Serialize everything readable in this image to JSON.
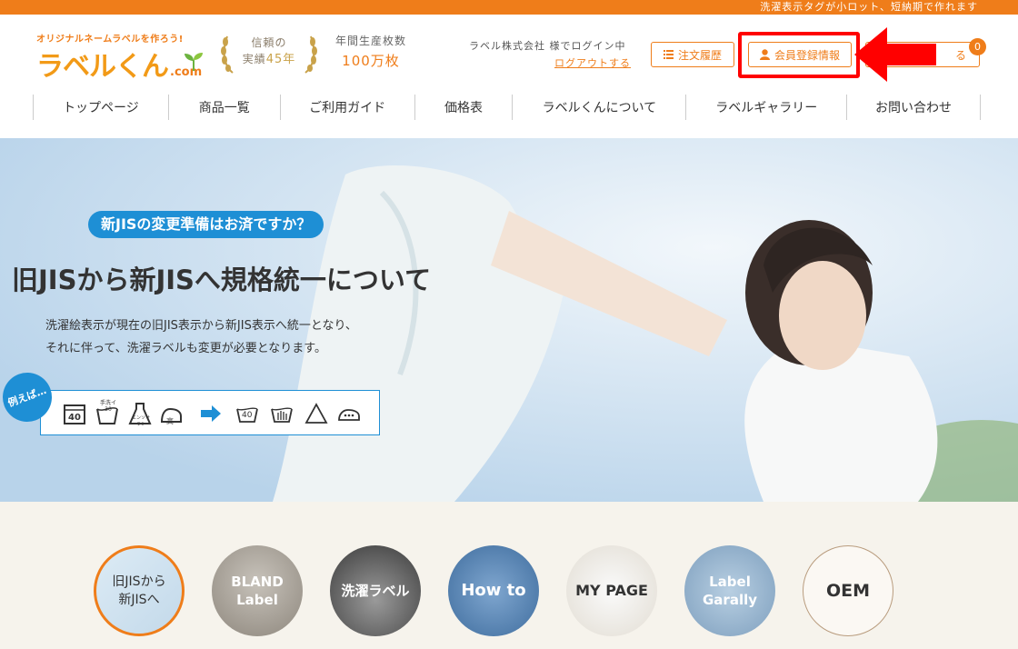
{
  "topbar": {
    "notice": "洗濯表示タグが小ロット、短納期で作れます"
  },
  "logo": {
    "tagline": "オリジナルネームラベルを作ろう!",
    "name": "ラベルくん",
    "domain": ".com"
  },
  "award": {
    "line1": "信頼の",
    "line2_prefix": "実績",
    "years": "45年"
  },
  "production": {
    "label": "年間生産枚数",
    "value": "100万枚"
  },
  "account": {
    "login_status": "ラベル株式会社 様でログイン中",
    "logout": "ログアウトする"
  },
  "header_buttons": {
    "history": "注文履歴",
    "member": "会員登録情報",
    "cart": "る",
    "cart_count": "0"
  },
  "nav": [
    "トップページ",
    "商品一覧",
    "ご利用ガイド",
    "価格表",
    "ラベルくんについて",
    "ラベルギャラリー",
    "お問い合わせ"
  ],
  "hero": {
    "pill": "新JISの変更準備はお済ですか？",
    "title": "旧JISから新JISへ規格統一について",
    "desc_line1": "洗濯絵表示が現在の旧JIS表示から新JIS表示へ統一となり、",
    "desc_line2": "それに伴って、洗濯ラベルも変更が必要となります。",
    "example_badge": "例えば…",
    "old_symbols": [
      "40",
      "手洗イ30",
      "エンソサラシ",
      "高"
    ],
    "new_symbols": [
      "40",
      "",
      "",
      ""
    ]
  },
  "circles": [
    {
      "label_line1": "旧JISから",
      "label_line2": "新JISへ"
    },
    {
      "label_line1": "BLAND",
      "label_line2": "Label"
    },
    {
      "label_line1": "洗濯ラベル",
      "label_line2": ""
    },
    {
      "label_line1": "How to",
      "label_line2": ""
    },
    {
      "label_line1": "MY PAGE",
      "label_line2": ""
    },
    {
      "label_line1": "Label",
      "label_line2": "Garally"
    },
    {
      "label_line1": "OEM",
      "label_line2": ""
    }
  ],
  "colors": {
    "brand_orange": "#ef7d1a",
    "accent_blue": "#1e8fd5",
    "highlight_red": "#ff0000"
  },
  "icons": [
    "list-icon",
    "user-icon",
    "arrow-right-icon",
    "laurel-icon",
    "sprout-icon"
  ]
}
